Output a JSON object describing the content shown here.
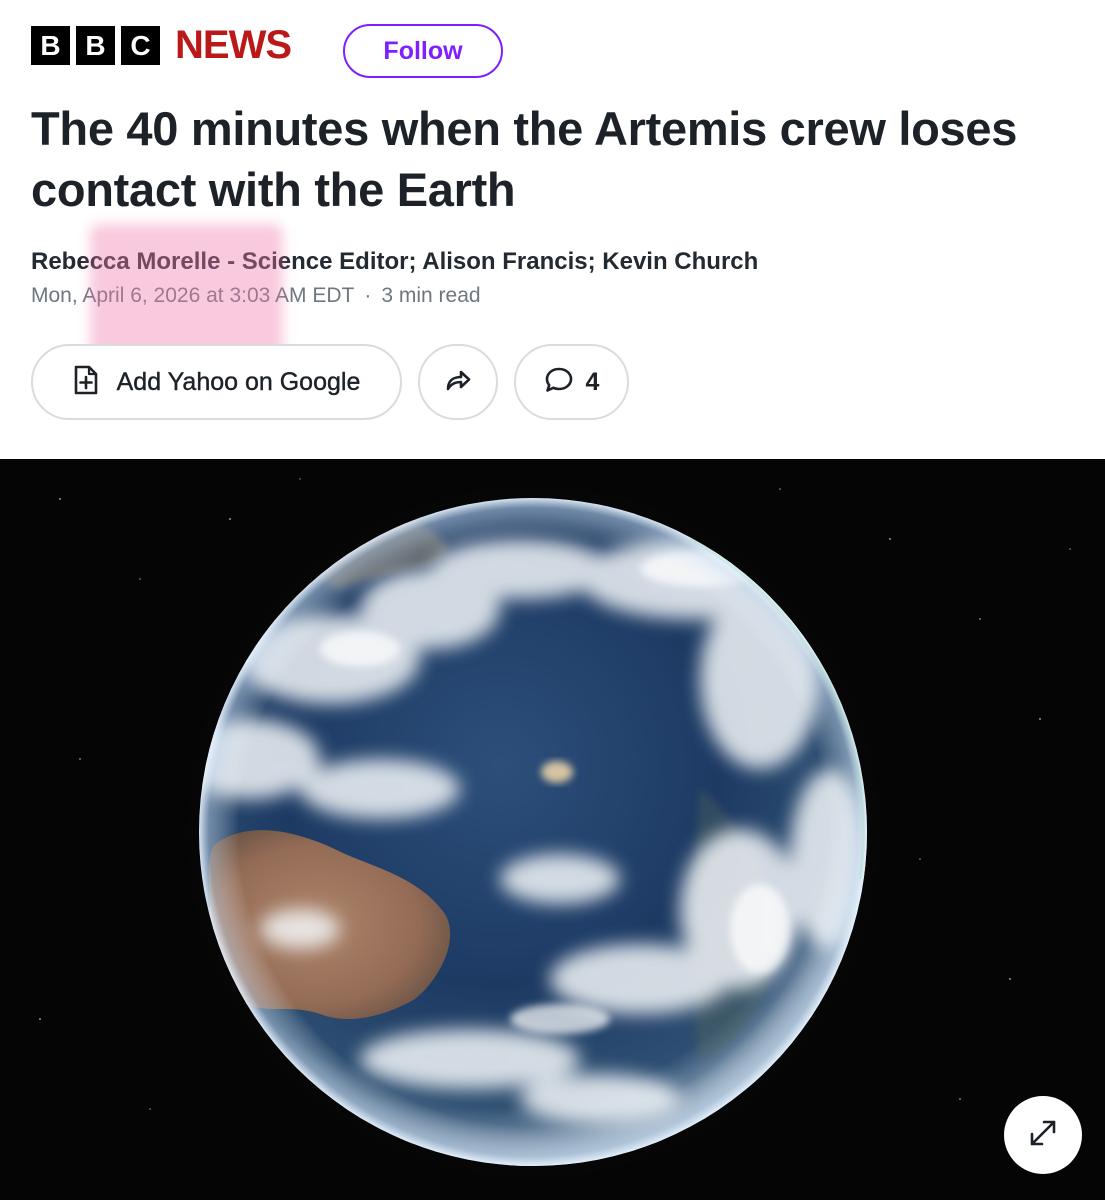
{
  "header": {
    "logo_letters": [
      "B",
      "B",
      "C"
    ],
    "logo_news": "NEWS",
    "follow_label": "Follow",
    "brand_color": "#bb1919",
    "accent_color": "#7e1fff"
  },
  "article": {
    "headline": "The 40 minutes when the Artemis crew loses contact with the Earth",
    "byline": "Rebecca Morelle - Science Editor; Alison Francis; Kevin Church",
    "date": "Mon, April 6, 2026 at 3:03 AM EDT",
    "separator": "·",
    "read_time": "3 min read"
  },
  "actions": {
    "google_label": "Add Yahoo on Google",
    "google_icon": "document-plus-icon",
    "share_icon": "share-arrow-icon",
    "comment_icon": "speech-bubble-icon",
    "comment_count": "4"
  },
  "hero_image": {
    "subject": "earth-from-space",
    "expand_icon": "expand-diagonal-icon"
  }
}
